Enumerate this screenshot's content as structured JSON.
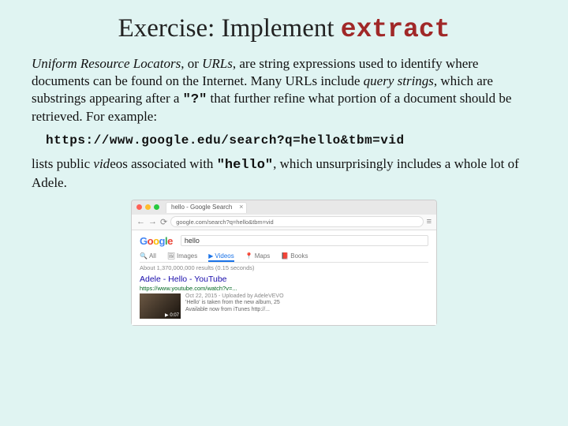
{
  "title": {
    "prefix": "Exercise: Implement ",
    "code": "extract"
  },
  "para1": {
    "t1": "Uniform Resource Locators",
    "t2": ", or ",
    "t3": "URLs",
    "t4": ", are string expressions used to identify where documents can be found on the Internet. Many URLs include ",
    "t5": "query strings",
    "t6": ", which are substrings appearing after a ",
    "t7": "\"?\"",
    "t8": " that further refine what portion of a document should be retrieved.  For example:"
  },
  "url_example": "https://www.google.edu/search?q=hello&tbm=vid",
  "para2": {
    "t1": "lists public ",
    "t2": "vid",
    "t3": "eos associated with ",
    "t4": "\"hello\"",
    "t5": ", which unsurprisingly includes a whole lot of Adele."
  },
  "browser": {
    "tab_title": "hello - Google Search",
    "address": "google.com/search?q=hello&tbm=vid",
    "search_term": "hello",
    "tabs": {
      "all": "All",
      "images": "Images",
      "videos": "Videos",
      "maps": "Maps",
      "books": "Books"
    },
    "stats": "About 1,370,000,000 results (0.15 seconds)",
    "result": {
      "title": "Adele - Hello - YouTube",
      "url": "https://www.youtube.com/watch?v=...",
      "date": "Oct 22, 2015 - Uploaded by AdeleVEVO",
      "line1": "'Hello' is taken from the new album, 25",
      "line2": "Available now from iTunes http://..."
    }
  }
}
